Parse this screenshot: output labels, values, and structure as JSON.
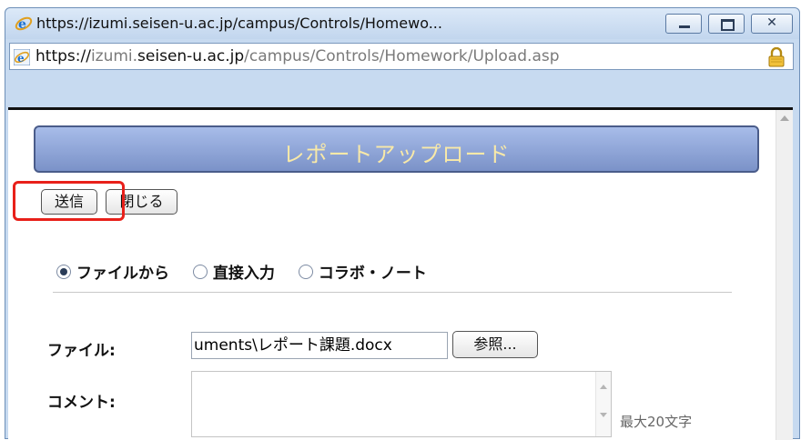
{
  "window": {
    "title": "https://izumi.seisen-u.ac.jp/campus/Controls/Homewo...",
    "close_glyph": "✕"
  },
  "address": {
    "scheme": "https://",
    "sub": "izumi.",
    "domain": "seisen-u.ac.jp",
    "path": "/campus/Controls/Homework/Upload.asp"
  },
  "page": {
    "header": "レポートアップロード",
    "send_label": "送信",
    "close_label": "閉じる",
    "radios": [
      {
        "label": "ファイルから",
        "checked": true
      },
      {
        "label": "直接入力",
        "checked": false
      },
      {
        "label": "コラボ・ノート",
        "checked": false
      }
    ],
    "file_label": "ファイル:",
    "file_value": "uments\\レポート課題.docx",
    "browse_label": "参照...",
    "comment_label": "コメント:",
    "comment_value": "",
    "comment_limit": "最大20文字"
  },
  "icons": [
    "ie-logo-icon",
    "lock-icon",
    "minimize-icon",
    "maximize-icon",
    "close-icon"
  ],
  "colors": {
    "accent": "#e8201a",
    "header_text": "#f8e9a8",
    "header_bg": "#8aa0d6"
  }
}
